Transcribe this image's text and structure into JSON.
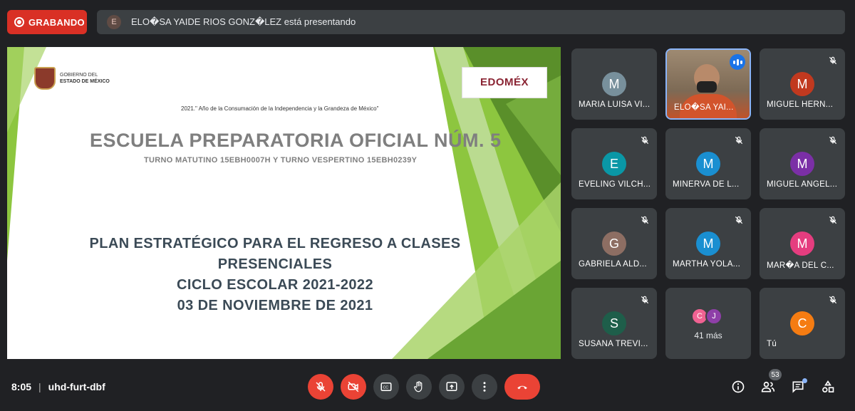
{
  "recording": {
    "label": "GRABANDO"
  },
  "presenting": {
    "initial": "E",
    "text": "ELO�SA YAIDE RIOS GONZ�LEZ está presentando"
  },
  "slide": {
    "gov_line1": "GOBIERNO DEL",
    "gov_line2": "ESTADO DE MÉXICO",
    "edomex_logo": "EDOMÉX",
    "motto": "2021.\" Año de la Consumación de la Independencia y la Grandeza de México\"",
    "school": "ESCUELA PREPARATORIA OFICIAL NÚM. 5",
    "shifts": "TURNO MATUTINO 15EBH0007H Y TURNO VESPERTINO 15EBH0239Y",
    "plan_line1": "PLAN ESTRATÉGICO PARA EL REGRESO A CLASES PRESENCIALES",
    "plan_line2": "CICLO ESCOLAR 2021-2022",
    "plan_line3": "03 DE NOVIEMBRE DE 2021",
    "colors": {
      "green_light": "#8dc63f",
      "green_dark": "#5a8f2a",
      "green_pale": "#c5e0a5"
    }
  },
  "participants": [
    {
      "initial": "M",
      "name": "MARIA LUISA VI...",
      "color": "#78909c",
      "muted": false
    },
    {
      "initial": "",
      "name": "ELO�SA YAI...",
      "color": "",
      "muted": false,
      "speaking": true
    },
    {
      "initial": "M",
      "name": "MIGUEL HERN...",
      "color": "#c1391f",
      "muted": true
    },
    {
      "initial": "E",
      "name": "EVELING VILCH...",
      "color": "#0a97a6",
      "muted": true
    },
    {
      "initial": "M",
      "name": "MINERVA DE L...",
      "color": "#1a8fd1",
      "muted": true
    },
    {
      "initial": "M",
      "name": "MIGUEL ANGEL...",
      "color": "#7b2fa6",
      "muted": true
    },
    {
      "initial": "G",
      "name": "GABRIELA ALD...",
      "color": "#8d6e63",
      "muted": true
    },
    {
      "initial": "M",
      "name": "MARTHA YOLA...",
      "color": "#1a8fd1",
      "muted": true
    },
    {
      "initial": "M",
      "name": "MAR�A DEL C...",
      "color": "#e53d7f",
      "muted": true
    },
    {
      "initial": "S",
      "name": "SUSANA TREVI...",
      "color": "#1e5e4a",
      "muted": true
    },
    {
      "initial": "",
      "name": "",
      "color": "",
      "muted": false,
      "more": true
    },
    {
      "initial": "C",
      "name": "Tú",
      "color": "#f57c12",
      "muted": true
    }
  ],
  "more_tile": {
    "avatar1": "C",
    "avatar1_color": "#f06292",
    "avatar2": "J",
    "avatar2_color": "#8e3fa8",
    "count_label": "41 más"
  },
  "bottom": {
    "time": "8:05",
    "separator": "|",
    "meeting_code": "uhd-furt-dbf",
    "people_count": "53",
    "icons": [
      "mic-off-icon",
      "camera-off-icon",
      "captions-icon",
      "raise-hand-icon",
      "present-icon",
      "more-vert-icon",
      "hangup-icon",
      "info-icon",
      "people-icon",
      "chat-icon",
      "activities-icon"
    ]
  }
}
